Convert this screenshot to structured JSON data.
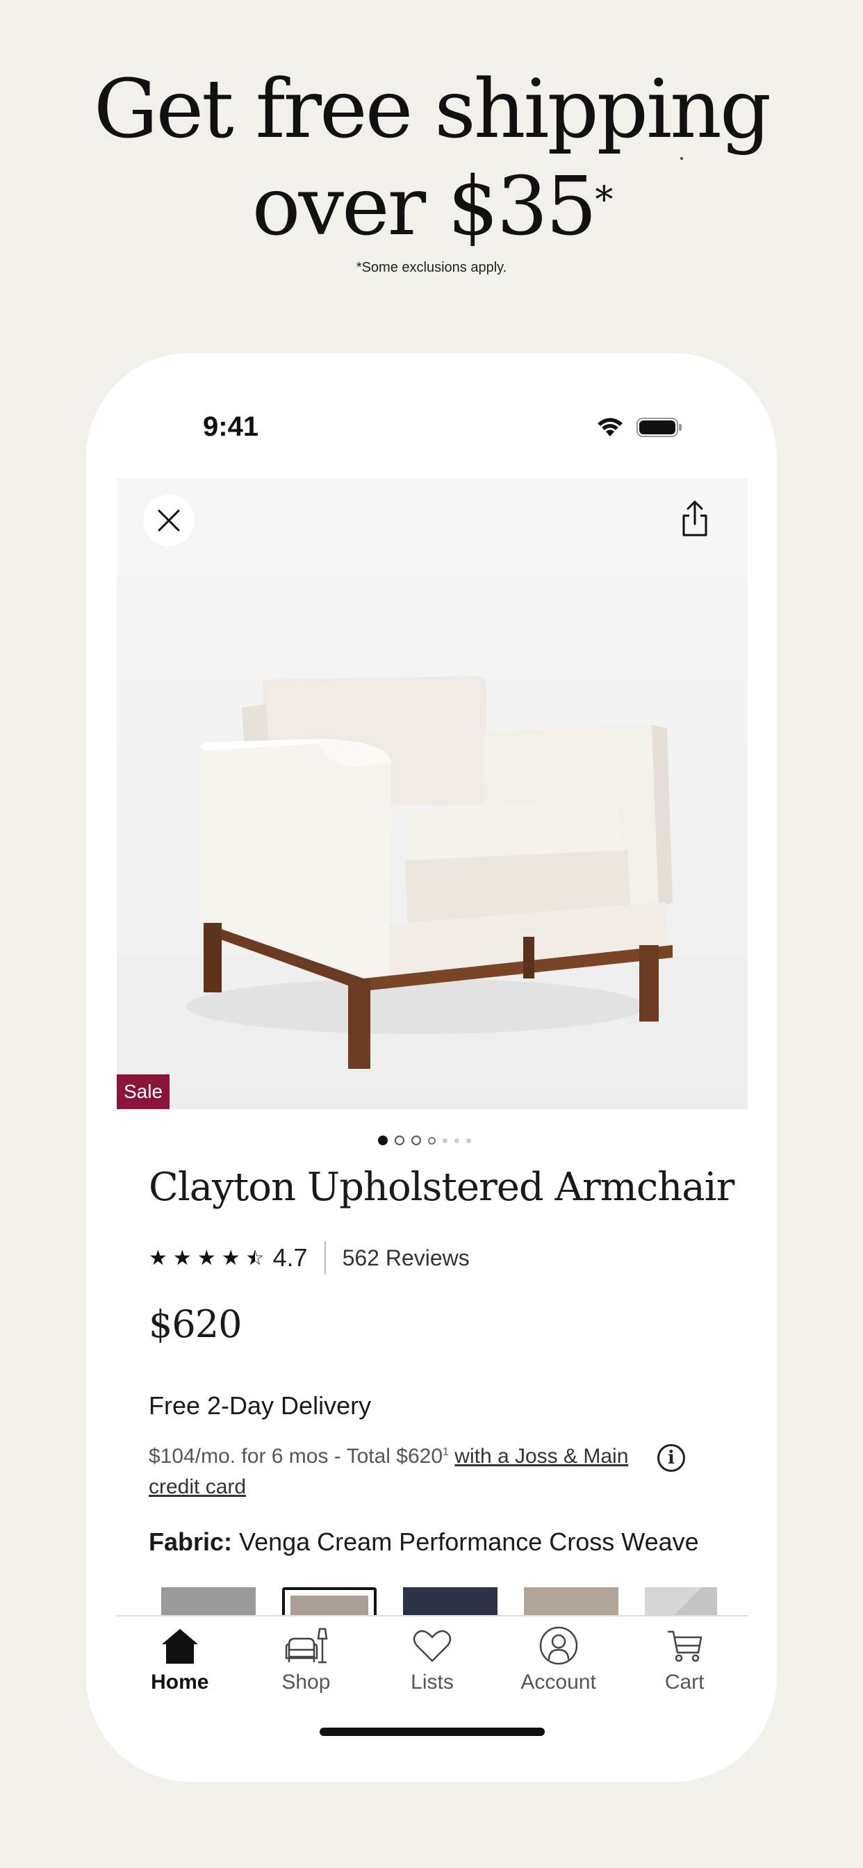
{
  "promo": {
    "headline_line1": "Get free shipping",
    "headline_line2": "over $35",
    "headline_asterisk": "*",
    "note": "*Some exclusions apply."
  },
  "status_bar": {
    "time": "9:41",
    "icons": [
      "wifi-icon",
      "battery-icon"
    ]
  },
  "product": {
    "badge": "Sale",
    "image_pages": 7,
    "image_current": 1,
    "title": "Clayton Upholstered Armchair",
    "rating_stars": 4.5,
    "rating_value": "4.7",
    "reviews": "562 Reviews",
    "price": "$620",
    "delivery": "Free 2-Day Delivery",
    "finance_text": "$104/mo. for 6 mos - Total $620",
    "finance_superscript": "1",
    "finance_link": "with a Joss & Main credit card",
    "fabric_label": "Fabric:",
    "fabric_value": "Venga Cream Performance Cross Weave",
    "swatches": [
      {
        "color": "#9a9a9a",
        "selected": false
      },
      {
        "color": "#a89e93",
        "selected": true
      },
      {
        "color": "#2b3344",
        "selected": false
      },
      {
        "color": "#b0a598",
        "selected": false
      },
      {
        "color": "#cfcfcf",
        "selected": false
      }
    ]
  },
  "tabbar": {
    "items": [
      {
        "label": "Home",
        "icon": "home-icon",
        "active": true
      },
      {
        "label": "Shop",
        "icon": "sofa-lamp-icon",
        "active": false
      },
      {
        "label": "Lists",
        "icon": "heart-icon",
        "active": false
      },
      {
        "label": "Account",
        "icon": "account-icon",
        "active": false
      },
      {
        "label": "Cart",
        "icon": "cart-icon",
        "active": false
      }
    ]
  },
  "colors": {
    "background": "#f3f0ec",
    "sale_badge": "#8a1538",
    "text": "#1a1a1a"
  }
}
